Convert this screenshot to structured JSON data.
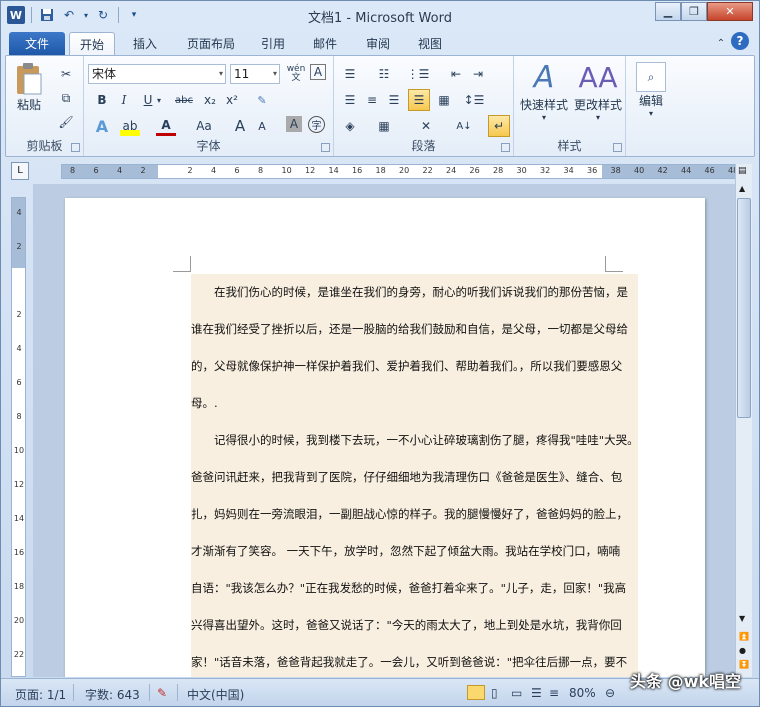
{
  "title_bar": {
    "title": "文档1 - Microsoft Word",
    "logo_letter": "W"
  },
  "tabs": [
    "文件",
    "开始",
    "插入",
    "页面布局",
    "引用",
    "邮件",
    "审阅",
    "视图"
  ],
  "ribbon": {
    "clipboard": {
      "paste_label": "粘贴",
      "group_label": "剪贴板"
    },
    "font": {
      "font_name": "宋体",
      "font_size": "11",
      "group_label": "字体",
      "wen": "wén\n文",
      "A_box": "A",
      "bold": "B",
      "italic": "I",
      "underline": "U",
      "strike": "abc",
      "sub": "x₂",
      "sup": "x²",
      "aa": "Aa",
      "grow": "A",
      "shrink": "A",
      "char_shade": "A",
      "enclose": "字"
    },
    "paragraph": {
      "group_label": "段落"
    },
    "styles": {
      "quick_styles": "快速样式",
      "change_styles": "更改样式",
      "group_label": "样式"
    },
    "editing": {
      "label": "编辑"
    }
  },
  "ruler": {
    "tab_symbol": "L",
    "h_ticks": [
      "8",
      "6",
      "4",
      "2",
      "",
      "2",
      "4",
      "6",
      "8",
      "10",
      "12",
      "14",
      "16",
      "18",
      "20",
      "22",
      "24",
      "26",
      "28",
      "30",
      "32",
      "34",
      "36",
      "38",
      "40",
      "42",
      "44",
      "46",
      "48"
    ],
    "v_ticks": [
      "4",
      "2",
      "",
      "2",
      "4",
      "6",
      "8",
      "10",
      "12",
      "14",
      "16",
      "18",
      "20",
      "22"
    ]
  },
  "document": {
    "paragraphs": [
      "　　在我们伤心的时候，是谁坐在我们的身旁，耐心的听我们诉说我们的那份苦恼，是",
      "谁在我们经受了挫折以后，还是一股脑的给我们鼓励和自信，是父母，一切都是父母给",
      "的，父母就像保护神一样保护着我们、爱护着我们、帮助着我们。，所以我们要感恩父",
      "母。.",
      "　　记得很小的时候，我到楼下去玩，一不小心让碎玻璃割伤了腿，疼得我\"哇哇\"大哭。",
      "爸爸问讯赶来，把我背到了医院，仔仔细细地为我清理伤口《爸爸是医生》、缝合、包",
      "扎，妈妈则在一旁流眼泪，一副胆战心惊的样子。我的腿慢慢好了，爸爸妈妈的脸上，",
      "才渐渐有了笑容。 一天下午，放学时，忽然下起了倾盆大雨。我站在学校门口，喃喃",
      "自语：\"我该怎么办？\"正在我发愁的时候，爸爸打着伞来了。\"儿子，走，回家！\"我高",
      "兴得喜出望外。这时，爸爸又说话了：\"今天的雨太大了，地上到处是水坑，我背你回",
      "家！\"话音未落，爸爸背起我就走了。一会儿，又听到爸爸说：\"把伞往后挪一点，要不"
    ]
  },
  "status_bar": {
    "page": "页面: 1/1",
    "words": "字数: 643",
    "language": "中文(中国)",
    "zoom": "80%"
  },
  "watermark": "头条 @wk唱空"
}
